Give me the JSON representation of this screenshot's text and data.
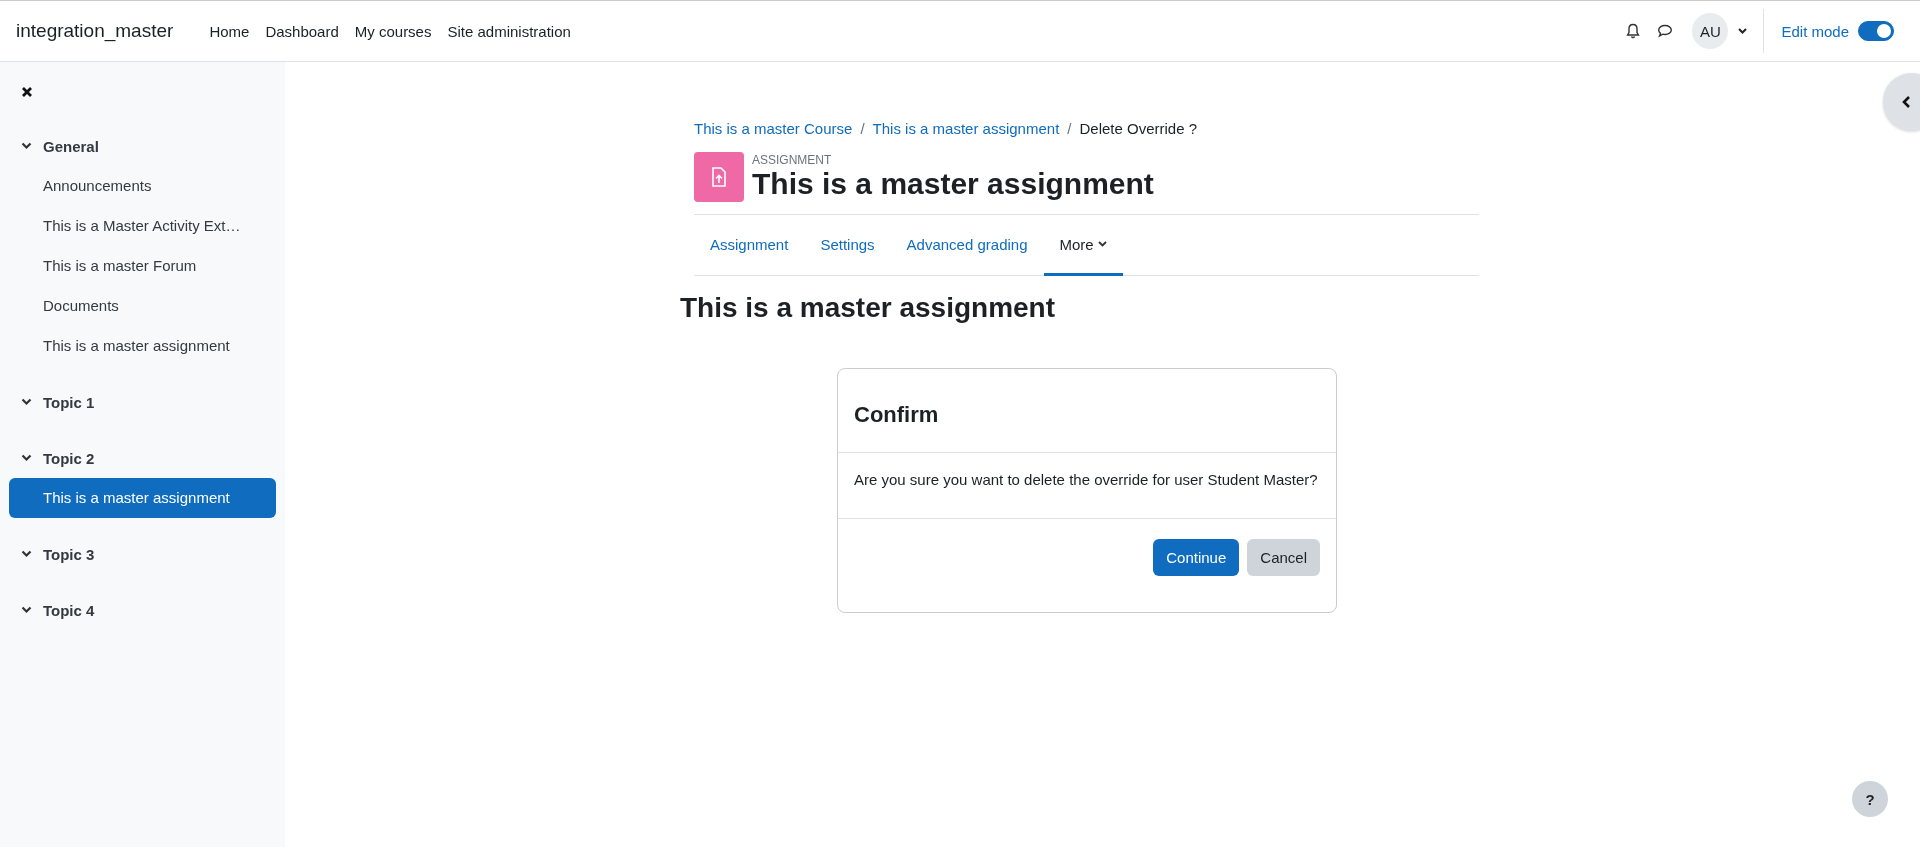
{
  "navbar": {
    "site_name": "integration_master",
    "links": [
      {
        "label": "Home"
      },
      {
        "label": "Dashboard"
      },
      {
        "label": "My courses"
      },
      {
        "label": "Site administration"
      }
    ],
    "avatar": "AU",
    "edit_mode": {
      "label": "Edit mode",
      "on": true
    }
  },
  "sidebar": {
    "sections": [
      {
        "title": "General",
        "expanded": true,
        "items": [
          {
            "label": "Announcements",
            "selected": false
          },
          {
            "label": "This is a Master Activity Ext…",
            "selected": false
          },
          {
            "label": "This is a master Forum",
            "selected": false
          },
          {
            "label": "Documents",
            "selected": false
          },
          {
            "label": "This is a master assignment",
            "selected": false
          }
        ]
      },
      {
        "title": "Topic 1",
        "expanded": true
      },
      {
        "title": "Topic 2",
        "expanded": true,
        "items": [
          {
            "label": "This is a master assignment",
            "selected": true
          }
        ]
      },
      {
        "title": "Topic 3",
        "expanded": true
      },
      {
        "title": "Topic 4",
        "expanded": true
      }
    ]
  },
  "breadcrumb": [
    {
      "label": "This is a master Course",
      "link": true
    },
    {
      "separator": "/",
      "label": "This is a master assignment",
      "link": true
    },
    {
      "separator": "/",
      "label": "Delete Override ?",
      "link": false
    }
  ],
  "activity": {
    "type_label": "ASSIGNMENT",
    "title": "This is a master assignment"
  },
  "tabs": [
    {
      "label": "Assignment",
      "selected": false,
      "dropdown": false
    },
    {
      "label": "Settings",
      "selected": false,
      "dropdown": false
    },
    {
      "label": "Advanced grading",
      "selected": false,
      "dropdown": false
    },
    {
      "label": "More",
      "selected": true,
      "dropdown": true
    }
  ],
  "page_heading": "This is a master assignment",
  "dialog": {
    "title": "Confirm",
    "message": "Are you sure you want to delete the override for user Student Master?",
    "buttons": [
      {
        "label": "Continue",
        "kind": "primary"
      },
      {
        "label": "Cancel",
        "kind": "secondary"
      }
    ]
  },
  "help_button": "?"
}
